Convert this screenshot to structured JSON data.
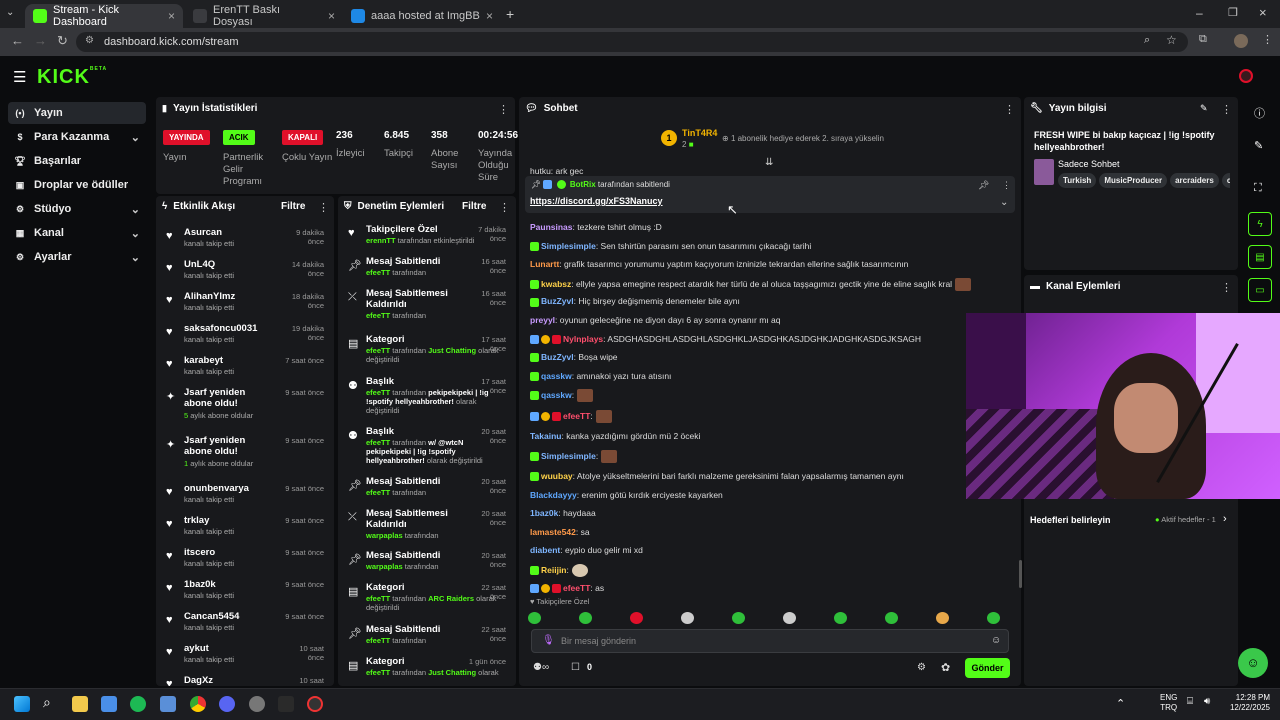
{
  "browser": {
    "tabs": [
      {
        "title": "Stream - Kick Dashboard",
        "active": true
      },
      {
        "title": "ErenTT Baskı Dosyası",
        "active": false
      },
      {
        "title": "aaaa hosted at ImgBB — ImgB",
        "active": false
      }
    ],
    "url": "dashboard.kick.com/stream"
  },
  "brand": {
    "logo": "KICK",
    "logo_sup": "BETA",
    "accent": "#53fc18"
  },
  "sidenav": [
    {
      "label": "Yayın",
      "icon": "broadcast-icon",
      "active": true,
      "chevron": false
    },
    {
      "label": "Para Kazanma",
      "icon": "dollar-icon",
      "chevron": true
    },
    {
      "label": "Başarılar",
      "icon": "trophy-icon",
      "chevron": false
    },
    {
      "label": "Droplar ve ödüller",
      "icon": "gift-icon",
      "chevron": false
    },
    {
      "label": "Stüdyo",
      "icon": "studio-icon",
      "chevron": true
    },
    {
      "label": "Kanal",
      "icon": "channel-icon",
      "chevron": true
    },
    {
      "label": "Ayarlar",
      "icon": "gear-icon",
      "chevron": true
    }
  ],
  "stats": {
    "title": "Yayın İstatistikleri",
    "items": [
      {
        "badge": "YAYINDA",
        "badge_color": "#e0102a",
        "label": "Yayın"
      },
      {
        "badge": "ACIK",
        "badge_color": "#53fc18",
        "label": "Partnerlik Gelir Programı"
      },
      {
        "badge": "KAPALI",
        "badge_color": "#e0102a",
        "label": "Çoklu Yayın"
      },
      {
        "value": "236",
        "label": "İzleyici"
      },
      {
        "value": "6.845",
        "label": "Takipçi"
      },
      {
        "value": "358",
        "label": "Abone Sayısı"
      },
      {
        "value": "00:24:56",
        "label": "Yayında Olduğu Süre"
      }
    ]
  },
  "activity": {
    "title": "Etkinlik Akışı",
    "filter": "Filtre",
    "items": [
      {
        "icon": "heart-icon",
        "name": "Asurcan",
        "sub": "kanalı takip etti",
        "time": "9 dakika önce"
      },
      {
        "icon": "heart-icon",
        "name": "UnL4Q",
        "sub": "kanalı takip etti",
        "time": "14 dakika önce"
      },
      {
        "icon": "heart-icon",
        "name": "AlihanYlmz",
        "sub": "kanalı takip etti",
        "time": "18 dakika önce"
      },
      {
        "icon": "heart-icon",
        "name": "saksafoncu0031",
        "sub": "kanalı takip etti",
        "time": "19 dakika önce"
      },
      {
        "icon": "heart-icon",
        "name": "karabeyt",
        "sub": "kanalı takip etti",
        "time": "7 saat önce"
      },
      {
        "icon": "star-icon",
        "name": "Jsarf yeniden abone oldu!",
        "sub_green": "5",
        "sub": " aylık abone oldular",
        "time": "9 saat önce"
      },
      {
        "icon": "star-icon",
        "name": "Jsarf yeniden abone oldu!",
        "sub_green": "1",
        "sub": " aylık abone oldular",
        "time": "9 saat önce"
      },
      {
        "icon": "heart-icon",
        "name": "onunbenvarya",
        "sub": "kanalı takip etti",
        "time": "9 saat önce"
      },
      {
        "icon": "heart-icon",
        "name": "trklay",
        "sub": "kanalı takip etti",
        "time": "9 saat önce"
      },
      {
        "icon": "heart-icon",
        "name": "itscero",
        "sub": "kanalı takip etti",
        "time": "9 saat önce"
      },
      {
        "icon": "heart-icon",
        "name": "1baz0k",
        "sub": "kanalı takip etti",
        "time": "9 saat önce"
      },
      {
        "icon": "heart-icon",
        "name": "Cancan5454",
        "sub": "kanalı takip etti",
        "time": "9 saat önce"
      },
      {
        "icon": "heart-icon",
        "name": "aykut",
        "sub": "kanalı takip etti",
        "time": "10 saat önce"
      },
      {
        "icon": "heart-icon",
        "name": "DagXz",
        "sub": "",
        "time": "10 saat önce"
      }
    ]
  },
  "moderation": {
    "title": "Denetim Eylemleri",
    "filter": "Filtre",
    "items": [
      {
        "icon": "heart-icon",
        "name": "Takipçilere Özel",
        "who": "erennTT",
        "rest": " tarafından etkinleştirildi",
        "time": "7 dakika önce"
      },
      {
        "icon": "pin-icon",
        "name": "Mesaj Sabitlendi",
        "who": "efeeTT",
        "rest": " tarafından",
        "time": "16 saat önce"
      },
      {
        "icon": "unpin-icon",
        "name": "Mesaj Sabitlemesi Kaldırıldı",
        "who": "efeeTT",
        "rest": " tarafından",
        "time": "16 saat önce"
      },
      {
        "icon": "category-icon",
        "name": "Kategori",
        "who": "efeeTT",
        "rest": " tarafından ",
        "hl": "Just Chatting",
        "rest2": " olarak değiştirildi",
        "time": "17 saat önce"
      },
      {
        "icon": "title-icon",
        "name": "Başlık",
        "who": "efeeTT",
        "rest": " tarafından ",
        "hl_white": "pekipekipeki | !ig !spotify hellyeahbrother!",
        "rest2": " olarak değiştirildi",
        "time": "17 saat önce"
      },
      {
        "icon": "title-icon",
        "name": "Başlık",
        "who": "efeeTT",
        "rest": " tarafından ",
        "hl_white": "w/ @wtcN pekipekipeki | !ig !spotify hellyeahbrother!",
        "rest2": " olarak değiştirildi",
        "time": "20 saat önce"
      },
      {
        "icon": "pin-icon",
        "name": "Mesaj Sabitlendi",
        "who": "efeeTT",
        "rest": " tarafından",
        "time": "20 saat önce"
      },
      {
        "icon": "unpin-icon",
        "name": "Mesaj Sabitlemesi Kaldırıldı",
        "who": "warpaplas",
        "rest": " tarafından",
        "time": "20 saat önce"
      },
      {
        "icon": "pin-icon",
        "name": "Mesaj Sabitlendi",
        "who": "warpaplas",
        "rest": " tarafından",
        "time": "20 saat önce"
      },
      {
        "icon": "category-icon",
        "name": "Kategori",
        "who": "efeeTT",
        "rest": " tarafından ",
        "hl": "ARC Raiders",
        "rest2": " olarak değiştirildi",
        "time": "22 saat önce"
      },
      {
        "icon": "pin-icon",
        "name": "Mesaj Sabitlendi",
        "who": "efeeTT",
        "rest": " tarafından",
        "time": "22 saat önce"
      },
      {
        "icon": "category-icon",
        "name": "Kategori",
        "who": "efeeTT",
        "rest": " tarafından ",
        "hl": "Just Chatting",
        "rest2": " olarak",
        "time": "1 gün önce"
      }
    ]
  },
  "chat": {
    "title": "Sohbet",
    "gift_user": "TinT4R4",
    "gift_count": "2",
    "gift_text": "1 abonelik hediye ederek 2. sıraya yükselin",
    "peek_line": "hutku: ark gec",
    "pinned_by": "BotRix",
    "pinned_by_text": " tarafından sabitlendi",
    "pinned_link": "https://discord.gg/xFS3Nanucy",
    "messages": [
      {
        "user": "Paunsinas",
        "color": "#c89bff",
        "text": ": tezkere tshirt olmuş :D"
      },
      {
        "user": "Simplesimple",
        "color": "#7fb6ff",
        "text": ": Sen tshirtün parasını sen onun tasarımını çıkacağı tarihi"
      },
      {
        "user": "Lunartt",
        "color": "#ff9a4a",
        "text": ": grafik tasarımcı yorumumu yaptım kaçıyorum izninizle tekrardan ellerine sağlık tasarımcının"
      },
      {
        "user": "kwabsz",
        "color": "#ffd24a",
        "text": ": ellyle yapsa emegine respect atardık her türlü de al oluca taşşagımızı gectik yine de eline saglık kral"
      },
      {
        "user": "BuzZyvl",
        "color": "#7fb6ff",
        "text": ": Hiç birşey değişmemiş denemeler bile aynı"
      },
      {
        "user": "preyyl",
        "color": "#c89bff",
        "text": ": oyunun geleceğine ne diyon dayı 6 ay sonra oynanır mı aq"
      },
      {
        "user": "Nylnplays",
        "color": "#ff4f6d",
        "text": ": ASDGHASDGHLASDGHLASDGHKLJASDGHKASJDGHKJADGHKASDGJKSAGH"
      },
      {
        "user": "BuzZyvl",
        "color": "#7fb6ff",
        "text": ": Boşa wipe"
      },
      {
        "user": "qasskw",
        "color": "#5fa8ff",
        "text": ": amınakoi yazı tura atısını"
      },
      {
        "user": "qasskw",
        "color": "#5fa8ff",
        "text": ":"
      },
      {
        "user": "efeeTT",
        "color": "#ff4f6d",
        "text": ":"
      },
      {
        "user": "Takainu",
        "color": "#7fb6ff",
        "text": ": kanka yazdığımı gördün mü 2 öceki"
      },
      {
        "user": "Simplesimple",
        "color": "#7fb6ff",
        "text": ":"
      },
      {
        "user": "wuubay",
        "color": "#ffd24a",
        "text": ": Atolye yükseltmelerini bari farklı malzeme gereksinimi falan yapsalarmış tamamen aynı"
      },
      {
        "user": "Blackdayyy",
        "color": "#5fa8ff",
        "text": ": erenim götü kırdık erciyeste kayarken"
      },
      {
        "user": "1baz0k",
        "color": "#7fb6ff",
        "text": ": haydaaa"
      },
      {
        "user": "lamaste542",
        "color": "#ff9a4a",
        "text": ": sa"
      },
      {
        "user": "diabent",
        "color": "#7fb6ff",
        "text": ": eypio duo gelir mi xd"
      },
      {
        "user": "Reiijin",
        "color": "#ffd24a",
        "text": ":"
      },
      {
        "user": "efeeTT",
        "color": "#ff4f6d",
        "text": ": as"
      }
    ],
    "followers_only": "Takipçilere Özel",
    "input_placeholder": "Bir mesaj gönderin",
    "points": "0",
    "send_label": "Gönder"
  },
  "stream_info": {
    "title": "Yayın bilgisi",
    "stream_title": "FRESH WIPE bi bakıp kaçıcaz | !ig !spotify hellyeahbrother!",
    "category": "Sadece Sohbet",
    "tags": [
      "Turkish",
      "MusicProducer",
      "arcraiders",
      "cs"
    ]
  },
  "channel_actions": {
    "title": "Kanal Eylemleri",
    "goals_label": "Hedefleri belirleyin",
    "goals_status": "Aktif hedefler - 1"
  },
  "taskbar": {
    "lang": "ENG",
    "region": "TRQ",
    "time": "12:28 PM",
    "date": "12/22/2025"
  }
}
